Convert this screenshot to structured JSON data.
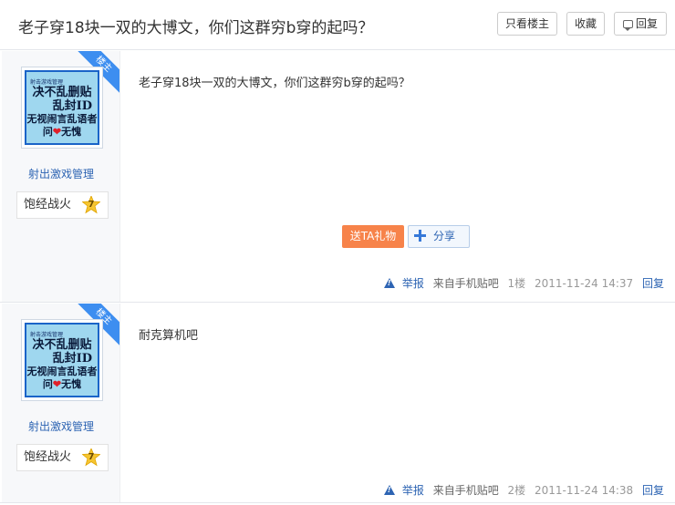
{
  "header": {
    "title": "老子穿18块一双的大博文，你们这群穷b穿的起吗？",
    "buttons": {
      "only_op": "只看楼主",
      "favorite": "收藏",
      "reply": "回复"
    }
  },
  "posts": [
    {
      "corner_badge": "楼主",
      "avatar_text": {
        "line1": "射击游戏管理",
        "line2": "决不乱删贴",
        "line3": "乱封ID",
        "line4": "无视闹言乱语者",
        "line5_a": "问",
        "heart": "❤",
        "line5_b": "无愧"
      },
      "username": "射出激戏管理",
      "badge_title": "饱经战火",
      "level": "7",
      "content": "老子穿18块一双的大博文，你们这群穷b穿的起吗？",
      "actions": {
        "gift": "送TA礼物",
        "share": "分享"
      },
      "meta": {
        "report": "举报",
        "via": "来自手机贴吧",
        "floor": "1楼",
        "time": "2011-11-24 14:37",
        "reply": "回复"
      }
    },
    {
      "corner_badge": "楼主",
      "avatar_text": {
        "line1": "射击游戏管理",
        "line2": "决不乱删贴",
        "line3": "乱封ID",
        "line4": "无视闹言乱语者",
        "line5_a": "问",
        "heart": "❤",
        "line5_b": "无愧"
      },
      "username": "射出激戏管理",
      "badge_title": "饱经战火",
      "level": "7",
      "content": "耐克算机吧",
      "meta": {
        "report": "举报",
        "via": "来自手机贴吧",
        "floor": "2楼",
        "time": "2011-11-24 14:38",
        "reply": "回复"
      }
    }
  ],
  "colors": {
    "accent_blue": "#2d64b3",
    "gift_orange": "#f7834a",
    "corner_blue": "#3d8ef0"
  },
  "icons": {
    "reply": "comment-icon",
    "share": "plus-icon",
    "report": "warning-icon",
    "level": "star-icon"
  }
}
